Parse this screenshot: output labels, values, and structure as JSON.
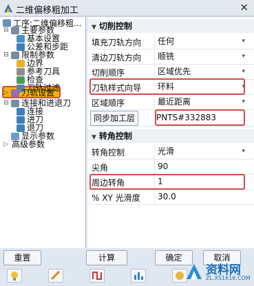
{
  "window": {
    "title": "二维偏移粗加工",
    "close_glyph": "✕"
  },
  "tree": {
    "root": "工序:二维偏移粗...",
    "items": [
      {
        "label": "主要参数",
        "level": 1,
        "glyph": "⊟"
      },
      {
        "label": "基本设置",
        "level": 2
      },
      {
        "label": "公差和步距",
        "level": 2
      },
      {
        "label": "限制参数",
        "level": 1,
        "glyph": "⊟"
      },
      {
        "label": "边界",
        "level": 2
      },
      {
        "label": "参考刀具",
        "level": 2
      },
      {
        "label": "检查",
        "level": 2
      },
      {
        "label": "刀轨过滤",
        "level": 2
      },
      {
        "label": "刀轨设置",
        "level": 1,
        "glyph": "▷"
      },
      {
        "label": "连接和进退刀",
        "level": 1,
        "glyph": "⊟"
      },
      {
        "label": "连接",
        "level": 2
      },
      {
        "label": "进刀",
        "level": 2
      },
      {
        "label": "退刀",
        "level": 2
      },
      {
        "label": "显示参数",
        "level": 1
      },
      {
        "label": "高级参数",
        "level": 1,
        "glyph": "▷"
      }
    ]
  },
  "panel": {
    "section1": "切削控制",
    "rows1": [
      {
        "label": "填充刀轨方向",
        "value": "任何"
      },
      {
        "label": "清边刀轨方向",
        "value": "顺铣"
      },
      {
        "label": "切削顺序",
        "value": "区域优先"
      },
      {
        "label": "刀轨样式向导",
        "value": "环料"
      },
      {
        "label": "区域顺序",
        "value": "最近距离"
      }
    ],
    "sync_button": "同步加工层",
    "sync_value": "PNTS#332883",
    "section2": "转角控制",
    "rows2": [
      {
        "label": "转角控制",
        "value": "光滑"
      },
      {
        "label": "尖角",
        "value": "90"
      },
      {
        "label": "周边转角",
        "value": "1"
      },
      {
        "label": "% XY 光滑度",
        "value": "30.0"
      }
    ]
  },
  "buttons": {
    "reset": "重置",
    "calc": "计算",
    "ok": "确定",
    "cancel": "取消"
  },
  "watermark": {
    "brand": "资料网",
    "url": "ZL.XS1616.COM"
  }
}
